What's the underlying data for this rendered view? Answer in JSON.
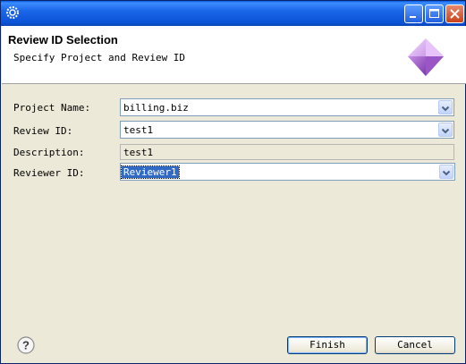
{
  "window": {
    "title": ""
  },
  "banner": {
    "title": "Review ID Selection",
    "subtitle": "Specify Project and Review ID"
  },
  "form": {
    "project_name": {
      "label": "Project Name:",
      "value": "billing.biz"
    },
    "review_id": {
      "label": "Review ID:",
      "value": "test1"
    },
    "description": {
      "label": "Description:",
      "value": "test1"
    },
    "reviewer_id": {
      "label": "Reviewer ID:",
      "value": "Reviewer1"
    }
  },
  "footer": {
    "finish_label": "Finish",
    "cancel_label": "Cancel"
  },
  "colors": {
    "titlebar": "#0b52d6",
    "selection": "#316ac5",
    "dialog_bg": "#ece9d8"
  }
}
